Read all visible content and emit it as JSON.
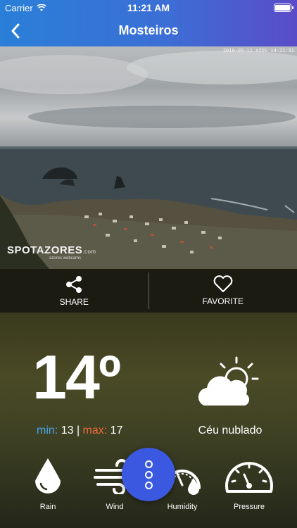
{
  "status_bar": {
    "carrier": "Carrier",
    "time": "11:21 AM"
  },
  "nav": {
    "title": "Mosteiros"
  },
  "webcam": {
    "timestamp": "2016-05-11 AZOS 14:21:31",
    "logo_text": "SPOTAZORES",
    "logo_suffix": ".com",
    "tagline": "azores webcams"
  },
  "actions": {
    "share_label": "SHARE",
    "favorite_label": "FAVORITE"
  },
  "weather": {
    "temperature": "14º",
    "min_label": "min:",
    "min_value": "13",
    "separator": "|",
    "max_label": "max:",
    "max_value": "17",
    "condition": "Céu nublado",
    "condition_icon": "partly-cloudy-icon"
  },
  "metrics": [
    {
      "label": "Rain",
      "icon": "raindrop-icon"
    },
    {
      "label": "Wind",
      "icon": "wind-icon"
    },
    {
      "label": "Humidity",
      "icon": "humidity-icon"
    },
    {
      "label": "Pressure",
      "icon": "pressure-gauge-icon"
    }
  ],
  "colors": {
    "min": "#4aa3e6",
    "max": "#f06a3a",
    "fab": "#3b58e0"
  }
}
